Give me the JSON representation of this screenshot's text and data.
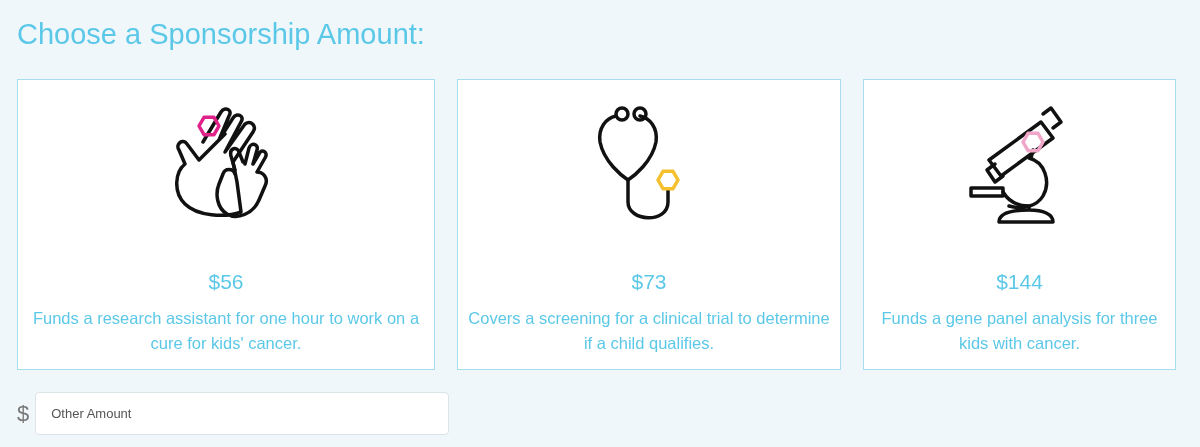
{
  "title": "Choose a Sponsorship Amount:",
  "options": [
    {
      "kind": "hands",
      "color": "#e0218a",
      "amount": "$56",
      "description": "Funds a research assistant for one hour to work on a cure for kids' cancer."
    },
    {
      "kind": "stethoscope",
      "color": "#f5c02e",
      "amount": "$73",
      "description": "Covers a screening for a clinical trial to determine if a child qualifies."
    },
    {
      "kind": "microscope",
      "color": "#f0a6c8",
      "amount": "$144",
      "description": "Funds a gene panel analysis for three kids with cancer."
    }
  ],
  "other": {
    "currency": "$",
    "placeholder": "Other Amount"
  }
}
